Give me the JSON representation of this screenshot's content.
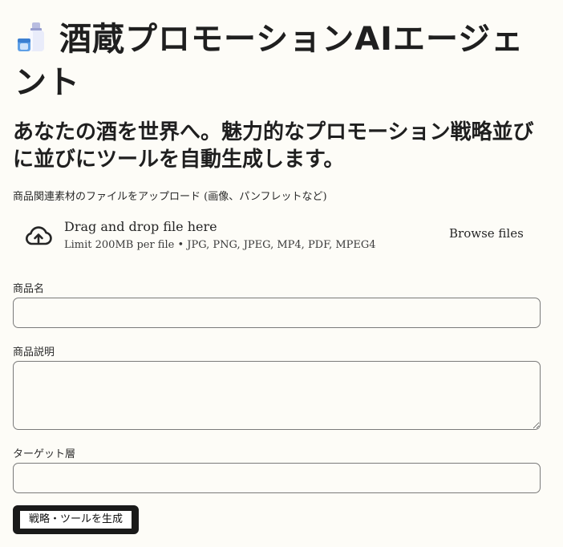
{
  "header": {
    "title": "酒蔵プロモーションAIエージェント",
    "title_icon": "sake-bottle-icon",
    "subtitle": "あなたの酒を世界へ。魅力的なプロモーション戦略並びに並びにツールを自動生成します。"
  },
  "upload": {
    "label": "商品関連素材のファイルをアップロード (画像、パンフレットなど)",
    "dropzone_text": "Drag and drop file here",
    "limit_text": "Limit 200MB per file • JPG, PNG, JPEG, MP4, PDF, MPEG4",
    "browse_label": "Browse files",
    "icon": "cloud-upload-icon"
  },
  "form": {
    "product_name_label": "商品名",
    "product_name_value": "",
    "product_description_label": "商品説明",
    "product_description_value": "",
    "target_label": "ターゲット層",
    "target_value": "",
    "submit_label": "戦略・ツールを生成"
  },
  "colors": {
    "background": "#fdfcf7",
    "text": "#1f1f1f",
    "border": "#7a7a7a",
    "button_bg": "#1a1a1a"
  }
}
